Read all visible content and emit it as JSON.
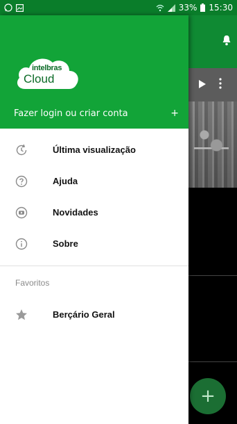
{
  "status_bar": {
    "battery": "33%",
    "time": "15:30"
  },
  "drawer": {
    "logo": {
      "top": "intelbras",
      "bottom": "Cloud"
    },
    "login_label": "Fazer login ou criar conta",
    "login_plus": "+",
    "menu_items": [
      {
        "label": "Última visualização",
        "icon": "history-icon"
      },
      {
        "label": "Ajuda",
        "icon": "help-icon"
      },
      {
        "label": "Novidades",
        "icon": "youtube-icon"
      },
      {
        "label": "Sobre",
        "icon": "info-icon"
      }
    ],
    "favorites_title": "Favoritos",
    "favorites": [
      {
        "label": "Berçário Geral",
        "icon": "star-icon"
      }
    ]
  },
  "background_app": {
    "fab_label": "+"
  },
  "colors": {
    "header_green": "#12a438",
    "status_green": "#0a7d2a",
    "icon_gray": "#8a8a8a"
  }
}
